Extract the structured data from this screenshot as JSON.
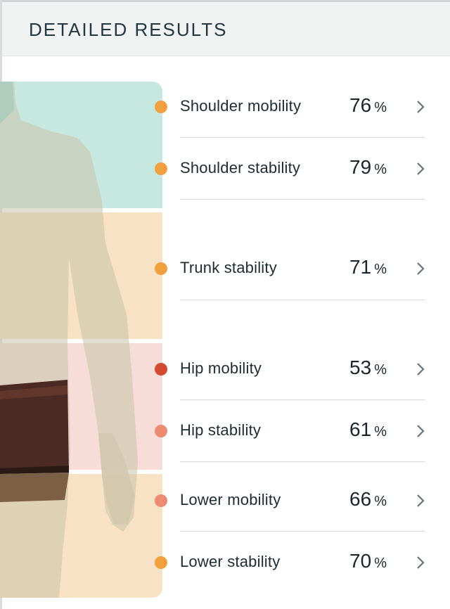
{
  "header": {
    "title": "DETAILED RESULTS"
  },
  "colors": {
    "orange": "#f0a03c",
    "red": "#d24a30",
    "salmon": "#ec8a72",
    "zone_shoulder": "#c7e8e0",
    "zone_trunk": "#f7e2c5",
    "zone_hip": "#f6ddd8",
    "zone_lower": "#f8e2c6"
  },
  "results": [
    {
      "label": "Shoulder mobility",
      "value": "76",
      "unit": "%",
      "status_color": "#f0a03c"
    },
    {
      "label": "Shoulder stability",
      "value": "79",
      "unit": "%",
      "status_color": "#f0a03c"
    },
    {
      "label": "Trunk stability",
      "value": "71",
      "unit": "%",
      "status_color": "#f0a03c"
    },
    {
      "label": "Hip mobility",
      "value": "53",
      "unit": "%",
      "status_color": "#d24a30"
    },
    {
      "label": "Hip stability",
      "value": "61",
      "unit": "%",
      "status_color": "#ec8a72"
    },
    {
      "label": "Lower mobility",
      "value": "66",
      "unit": "%",
      "status_color": "#ec8a72"
    },
    {
      "label": "Lower stability",
      "value": "70",
      "unit": "%",
      "status_color": "#f0a03c"
    }
  ],
  "icons": {
    "row_arrow": "chevron-right-icon",
    "figure": "body-figure"
  }
}
